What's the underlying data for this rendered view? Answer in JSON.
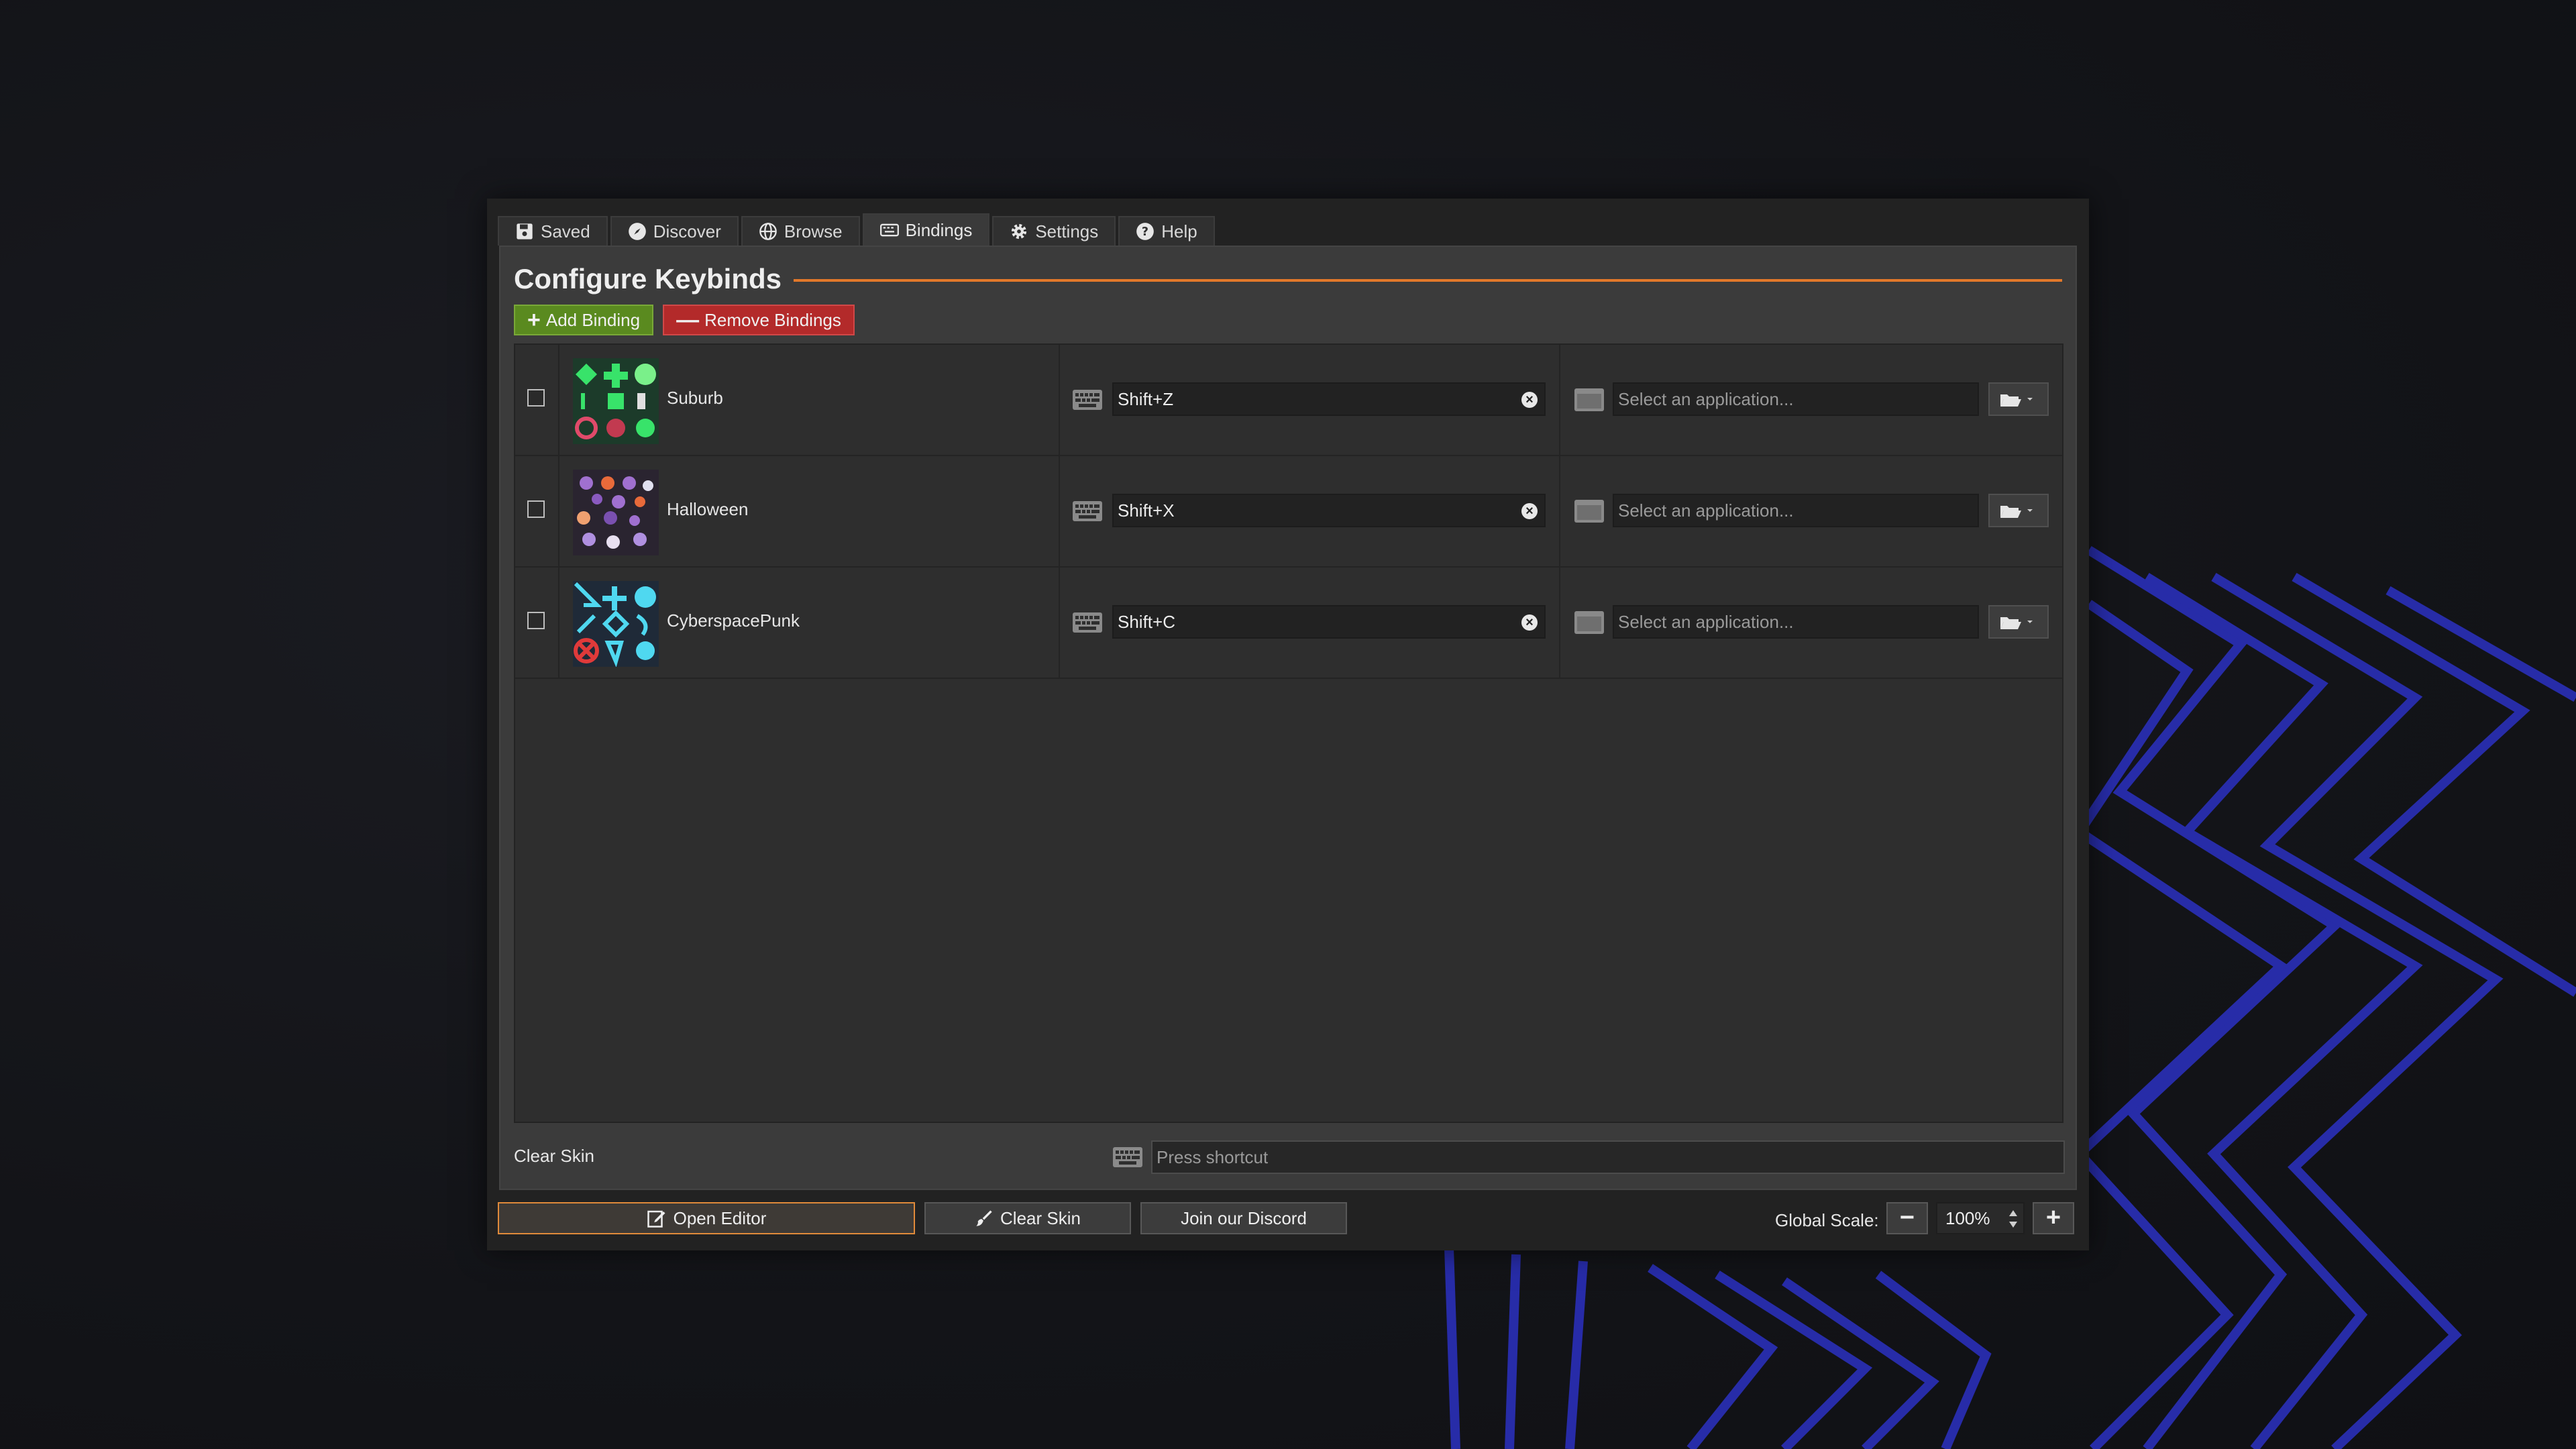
{
  "tabs": [
    {
      "label": "Saved",
      "icon": "save-icon"
    },
    {
      "label": "Discover",
      "icon": "compass-icon"
    },
    {
      "label": "Browse",
      "icon": "globe-icon"
    },
    {
      "label": "Bindings",
      "icon": "keyboard-icon",
      "active": true
    },
    {
      "label": "Settings",
      "icon": "gear-icon"
    },
    {
      "label": "Help",
      "icon": "help-icon"
    }
  ],
  "heading": "Configure Keybinds",
  "actions": {
    "add_label": "Add Binding",
    "remove_label": "Remove Bindings"
  },
  "bindings": [
    {
      "skin": "Suburb",
      "shortcut": "Shift+Z",
      "app_placeholder": "Select an application...",
      "checked": false
    },
    {
      "skin": "Halloween",
      "shortcut": "Shift+X",
      "app_placeholder": "Select an application...",
      "checked": false
    },
    {
      "skin": "CyberspacePunk",
      "shortcut": "Shift+C",
      "app_placeholder": "Select an application...",
      "checked": false
    }
  ],
  "clear_skin": {
    "label": "Clear Skin",
    "shortcut_placeholder": "Press shortcut"
  },
  "bottom": {
    "open_editor": "Open Editor",
    "clear_skin": "Clear Skin",
    "discord": "Join our Discord",
    "scale_label": "Global Scale:",
    "scale_value": "100%"
  },
  "colors": {
    "accent": "#e2782a",
    "add": "#5a8a1f",
    "remove": "#b32a2a",
    "background_lines": "#2a2fb8"
  }
}
